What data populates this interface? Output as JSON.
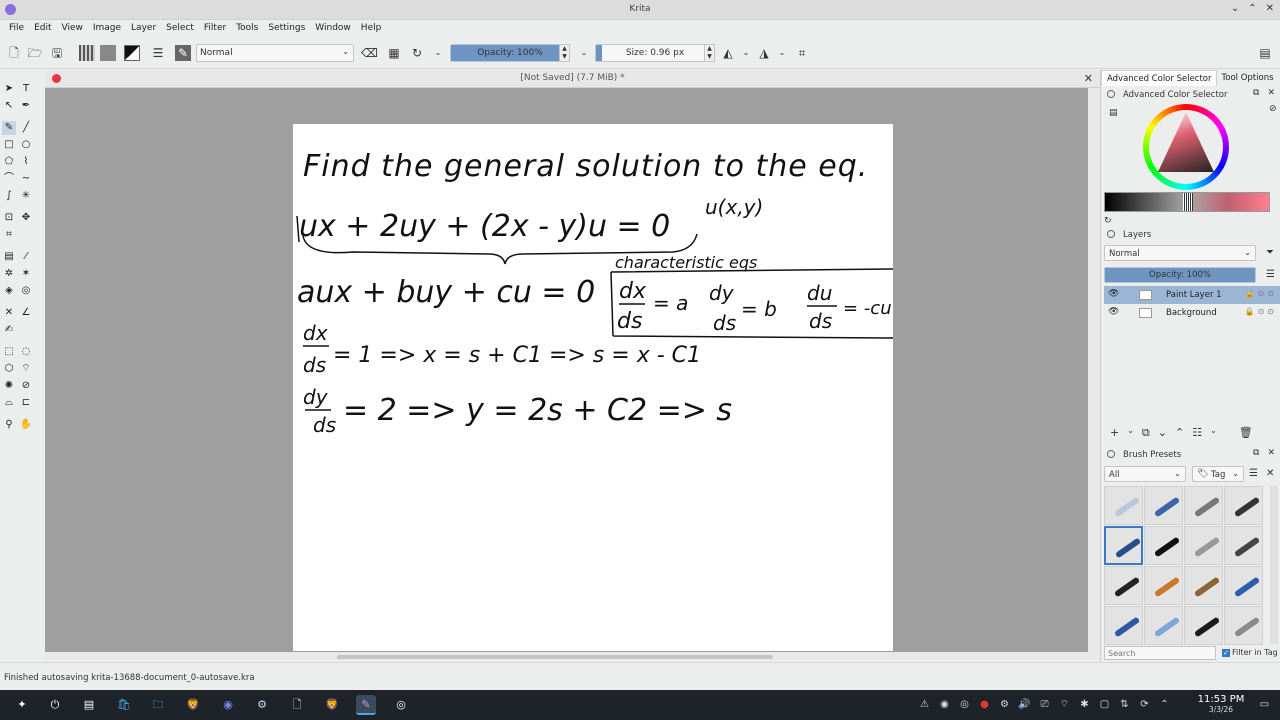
{
  "window": {
    "title": "Krita"
  },
  "menu": {
    "items": [
      "File",
      "Edit",
      "View",
      "Image",
      "Layer",
      "Select",
      "Filter",
      "Tools",
      "Settings",
      "Window",
      "Help"
    ]
  },
  "toolbar": {
    "blend_mode": "Normal",
    "opacity_label": "Opacity: 100%",
    "opacity_value": 1.0,
    "size_label": "Size: 0.96 px"
  },
  "document": {
    "tab_title": "[Not Saved]  (7.7 MiB) *",
    "handwriting": {
      "line1": "Find the general solution to the eq.",
      "note_u": "u(x,y)",
      "line2": "ux + 2uy + (2x - y)u = 0",
      "brace_label": "characteristic eqs",
      "line3": "aux + buy + cu = 0",
      "char_eq1_num": "dx",
      "char_eq1_den": "ds",
      "char_eq1_rhs": "= a",
      "char_eq2_num": "dy",
      "char_eq2_den": "ds",
      "char_eq2_rhs": "= b",
      "char_eq3_num": "du",
      "char_eq3_den": "ds",
      "char_eq3_rhs": "= -cu",
      "step1_num": "dx",
      "step1_den": "ds",
      "step1_rest": "= 1 => x = s + C1 => s = x - C1",
      "step2_num": "dy",
      "step2_den": "ds",
      "step2_rest": "= 2 => y = 2s + C2 => s"
    }
  },
  "right_panel": {
    "tabs": [
      "Advanced Color Selector",
      "Tool Options"
    ],
    "color_selector_title": "Advanced Color Selector",
    "layers_title": "Layers",
    "layers_blend": "Normal",
    "layers_opacity_label": "Opacity: 100%",
    "layers": [
      {
        "name": "Paint Layer 1",
        "selected": true
      },
      {
        "name": "Background",
        "selected": false
      }
    ],
    "brush_presets_title": "Brush Presets",
    "brush_filter": "All",
    "brush_tag": "Tag",
    "search_placeholder": "Search",
    "filter_in_tag": "Filter in Tag"
  },
  "status": {
    "message": "Finished autosaving krita-13688-document_0-autosave.kra"
  },
  "taskbar": {
    "time": "11:53 PM",
    "date": "3/3/26"
  },
  "colors": {
    "accent": "#3daee9",
    "selection": "#9bb5d4",
    "canvas_bg": "#9f9f9f",
    "taskbar": "#1e2329"
  }
}
